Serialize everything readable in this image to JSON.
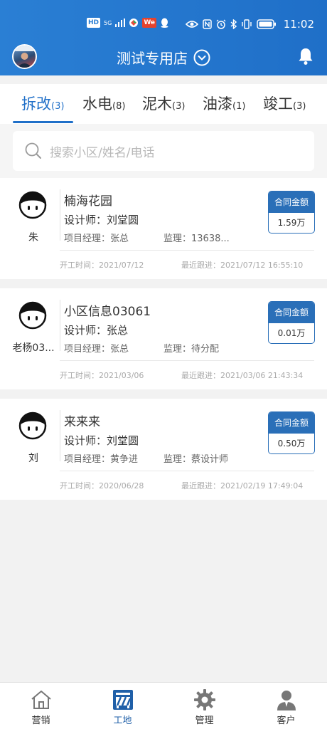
{
  "status_bar": {
    "network_badge": "HD",
    "network_type": "5G",
    "app_badge": "We",
    "time": "11:02"
  },
  "header": {
    "store_name": "测试专用店",
    "icons": [
      "avatar",
      "chevron-down-circle-icon",
      "bell-icon"
    ],
    "bg_color": "#2a7fd4"
  },
  "tabs": [
    {
      "label": "拆改",
      "count": "(3)",
      "active": true
    },
    {
      "label": "水电",
      "count": "(8)",
      "active": false
    },
    {
      "label": "泥木",
      "count": "(3)",
      "active": false
    },
    {
      "label": "油漆",
      "count": "(1)",
      "active": false
    },
    {
      "label": "竣工",
      "count": "(3)",
      "active": false
    }
  ],
  "search": {
    "placeholder": "搜索小区/姓名/电话"
  },
  "cards": [
    {
      "person": "朱",
      "project": "楠海花园",
      "designer": "设计师：刘堂圆",
      "manager": "项目经理：张总",
      "supervisor": "监理：13638...",
      "amount_label": "合同金额",
      "amount": "1.59万",
      "start": "开工时间：2021/07/12",
      "follow": "最近跟进：2021/07/12 16:55:10"
    },
    {
      "person": "老杨03...",
      "project": "小区信息03061",
      "designer": "设计师：张总",
      "manager": "项目经理：张总",
      "supervisor": "监理：待分配",
      "amount_label": "合同金额",
      "amount": "0.01万",
      "start": "开工时间：2021/03/06",
      "follow": "最近跟进：2021/03/06 21:43:34"
    },
    {
      "person": "刘",
      "project": "来来来",
      "designer": "设计师：刘堂圆",
      "manager": "项目经理：黄争进",
      "supervisor": "监理：蔡设计师",
      "amount_label": "合同金额",
      "amount": "0.50万",
      "start": "开工时间：2020/06/28",
      "follow": "最近跟进：2021/02/19 17:49:04"
    }
  ],
  "bottom_nav": [
    {
      "label": "营销",
      "icon": "house-icon",
      "active": false
    },
    {
      "label": "工地",
      "icon": "construction-site-icon",
      "active": true
    },
    {
      "label": "管理",
      "icon": "gear-icon",
      "active": false
    },
    {
      "label": "客户",
      "icon": "customer-icon",
      "active": false
    }
  ],
  "colors": {
    "accent": "#1f6fc8",
    "amount_header": "#2a6fb8"
  }
}
